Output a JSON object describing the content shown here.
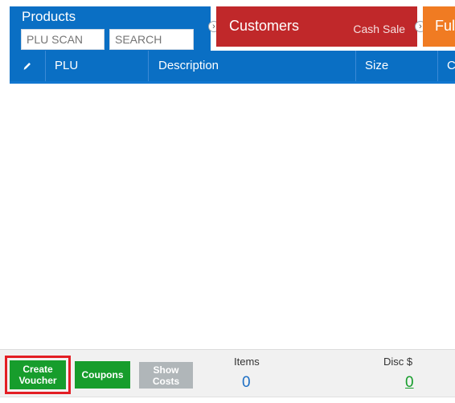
{
  "products": {
    "title": "Products",
    "plu_scan_placeholder": "PLU SCAN",
    "search_placeholder": "SEARCH"
  },
  "customers": {
    "label": "Customers",
    "status": "Cash Sale"
  },
  "fulfilment": {
    "label": "Fulfi"
  },
  "grid": {
    "columns": [
      "PLU",
      "Description",
      "Size",
      "C"
    ]
  },
  "footer": {
    "create_voucher_label": "Create Voucher",
    "coupons_label": "Coupons",
    "show_costs_label": "Show Costs",
    "items_label": "Items",
    "items_value": "0",
    "disc_label": "Disc $",
    "disc_value": "0"
  },
  "colors": {
    "primary_blue": "#0a6fc4",
    "customers_red": "#c0282a",
    "fulfilment_orange": "#f07b22",
    "action_green": "#179d2c",
    "highlight_red": "#e31e24",
    "disabled_gray": "#b0b6b9"
  }
}
